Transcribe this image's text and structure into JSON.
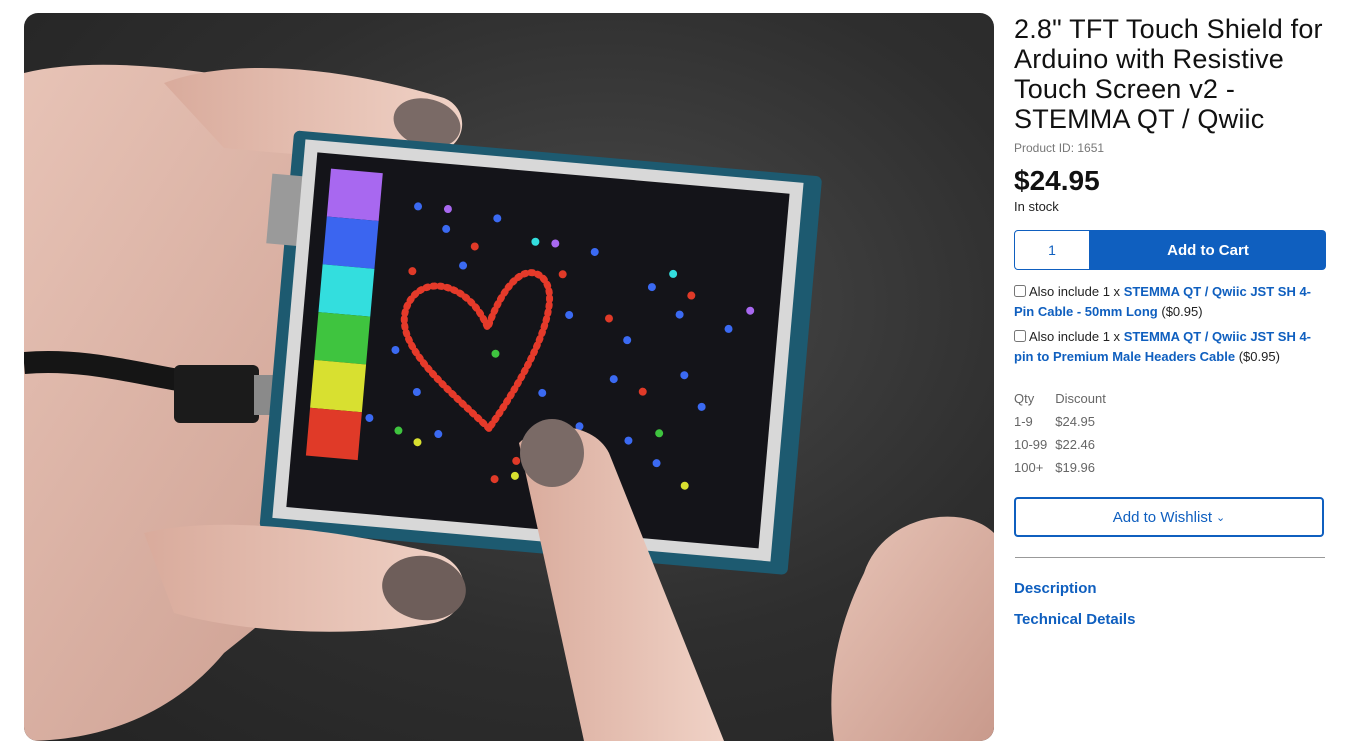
{
  "product": {
    "title": "2.8\" TFT Touch Shield for Arduino with Resistive Touch Screen v2 - STEMMA QT / Qwiic",
    "product_id": "Product ID: 1651",
    "price": "$24.95",
    "stock": "In stock"
  },
  "cart": {
    "quantity": "1",
    "add_label": "Add to Cart"
  },
  "addons": [
    {
      "prefix": "Also include 1 x",
      "link": "STEMMA QT / Qwiic JST SH 4-Pin Cable - 50mm Long",
      "price": "($0.95)"
    },
    {
      "prefix": "Also include 1 x",
      "link": "STEMMA QT / Qwiic JST SH 4-pin to Premium Male Headers Cable",
      "price": "($0.95)"
    }
  ],
  "discount": {
    "headers": [
      "Qty",
      "Discount"
    ],
    "rows": [
      [
        "1-9",
        "$24.95"
      ],
      [
        "10-99",
        "$22.46"
      ],
      [
        "100+",
        "$19.96"
      ]
    ]
  },
  "wishlist_label": "Add to Wishlist",
  "tabs": [
    "Description",
    "Technical Details"
  ],
  "colors": {
    "accent": "#0f5fbf"
  }
}
